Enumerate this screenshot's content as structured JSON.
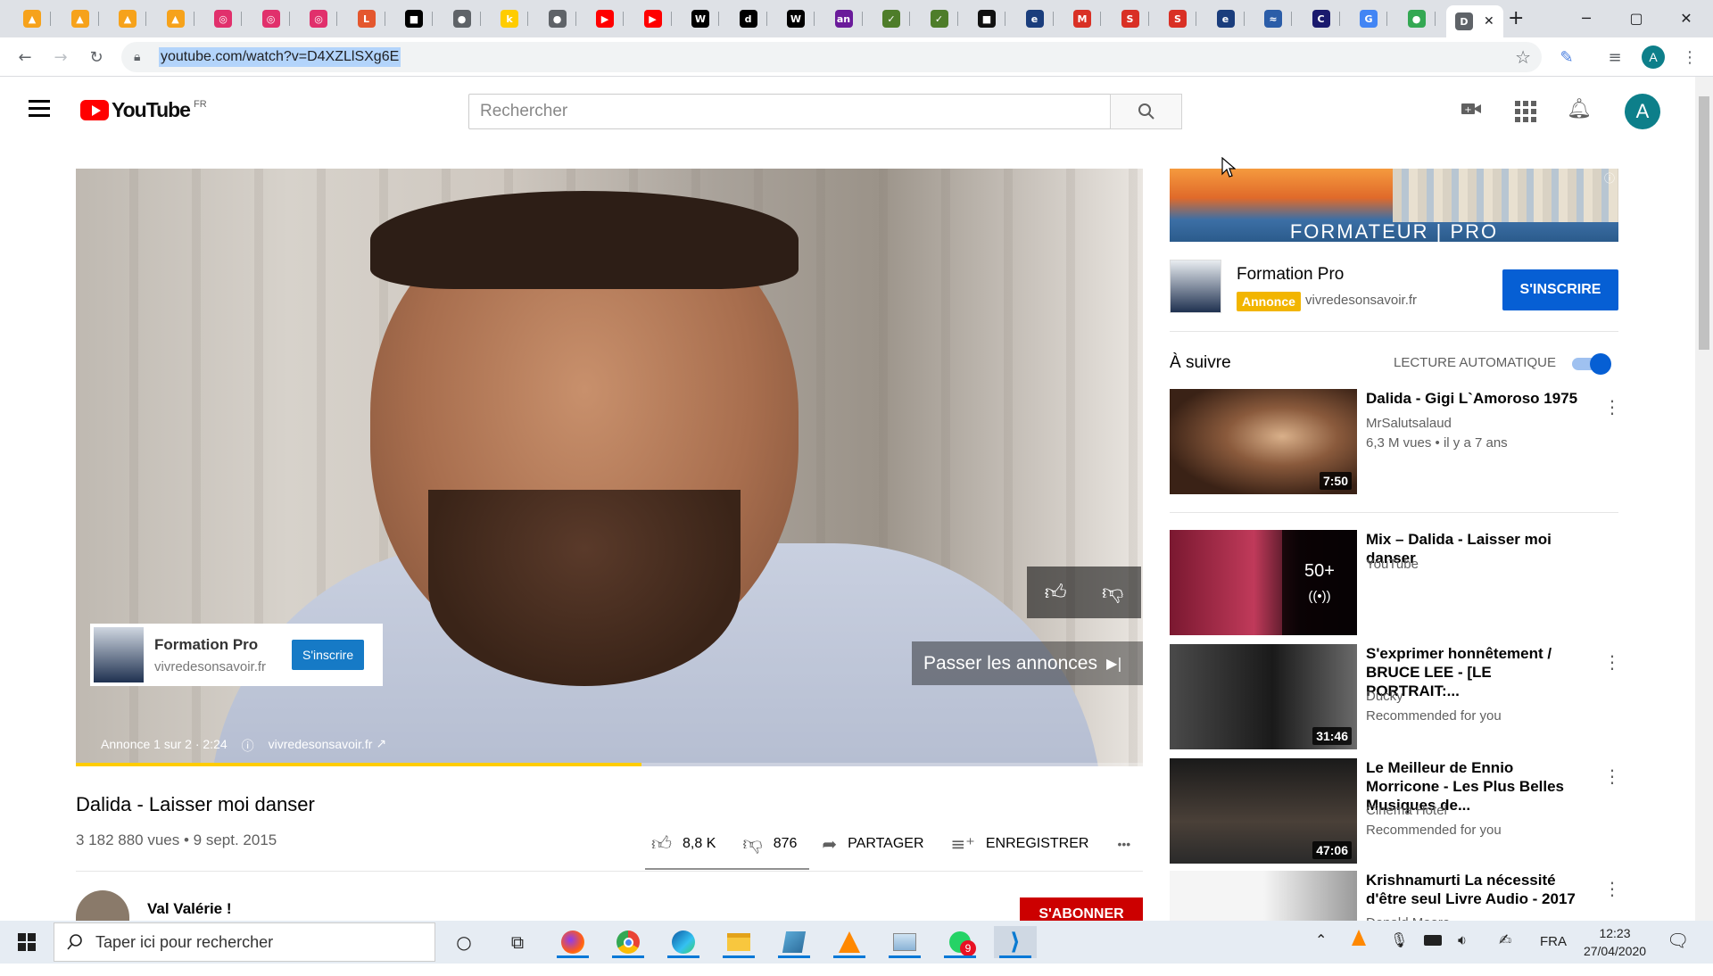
{
  "browser": {
    "tabs": [
      {
        "icon": "pma-icon",
        "glyph": "▲",
        "color": "#f6a21b"
      },
      {
        "icon": "pma-icon",
        "glyph": "▲",
        "color": "#f6a21b"
      },
      {
        "icon": "pma-icon",
        "glyph": "▲",
        "color": "#f6a21b"
      },
      {
        "icon": "pma-icon",
        "glyph": "▲",
        "color": "#f6a21b"
      },
      {
        "icon": "instagram-icon",
        "glyph": "◎",
        "color": "#e1306c"
      },
      {
        "icon": "instagram-icon",
        "glyph": "◎",
        "color": "#e1306c"
      },
      {
        "icon": "instagram-icon",
        "glyph": "◎",
        "color": "#e1306c"
      },
      {
        "icon": "l-icon",
        "glyph": "L",
        "color": "#e4572e"
      },
      {
        "icon": "square-icon",
        "glyph": "■",
        "color": "#000000"
      },
      {
        "icon": "globe-icon",
        "glyph": "●",
        "color": "#5f6368"
      },
      {
        "icon": "k-icon",
        "glyph": "k",
        "color": "#ffcc00"
      },
      {
        "icon": "globe-icon",
        "glyph": "●",
        "color": "#5f6368"
      },
      {
        "icon": "youtube-icon",
        "glyph": "▶",
        "color": "#ff0000"
      },
      {
        "icon": "youtube-icon",
        "glyph": "▶",
        "color": "#ff0000"
      },
      {
        "icon": "wikipedia-icon",
        "glyph": "W",
        "color": "#000000"
      },
      {
        "icon": "d-icon",
        "glyph": "d",
        "color": "#000000"
      },
      {
        "icon": "wikipedia-icon",
        "glyph": "W",
        "color": "#000000"
      },
      {
        "icon": "an-icon",
        "glyph": "an",
        "color": "#6a1b9a"
      },
      {
        "icon": "bird-icon",
        "glyph": "✓",
        "color": "#4e7d2a"
      },
      {
        "icon": "bird-icon",
        "glyph": "✓",
        "color": "#4e7d2a"
      },
      {
        "icon": "square-icon",
        "glyph": "■",
        "color": "#111111"
      },
      {
        "icon": "e-icon",
        "glyph": "e",
        "color": "#1a3d7c"
      },
      {
        "icon": "gmail-icon",
        "glyph": "M",
        "color": "#d93025"
      },
      {
        "icon": "sw-icon",
        "glyph": "S",
        "color": "#d93025"
      },
      {
        "icon": "sw-icon",
        "glyph": "S",
        "color": "#d93025"
      },
      {
        "icon": "e-icon",
        "glyph": "e",
        "color": "#1a3d7c"
      },
      {
        "icon": "ship-icon",
        "glyph": "≈",
        "color": "#2b5da8"
      },
      {
        "icon": "cpf-icon",
        "glyph": "C",
        "color": "#1a1a6e"
      },
      {
        "icon": "google-icon",
        "glyph": "G",
        "color": "#4285f4"
      },
      {
        "icon": "green-icon",
        "glyph": "●",
        "color": "#34a853"
      },
      {
        "icon": "d-icon",
        "glyph": "D",
        "color": "#5f6368"
      }
    ],
    "active_tab_close": "✕",
    "new_tab": "+",
    "url": "youtube.com/watch?v=D4XZLlSXg6E"
  },
  "youtube": {
    "logo_text": "YouTube",
    "region": "FR",
    "search_placeholder": "Rechercher",
    "avatar_letter": "A"
  },
  "player": {
    "like_dislike": [
      "thumb-up",
      "thumb-down"
    ],
    "ad_card": {
      "title": "Formation Pro",
      "domain": "vivredesonsavoir.fr",
      "button": "S'inscrire"
    },
    "skip_label": "Passer les annonces",
    "ad_info": "Annonce 1 sur 2 · 2:24",
    "ad_link": "vivredesonsavoir.fr",
    "progress_fraction": 0.53
  },
  "video": {
    "title": "Dalida - Laisser moi danser",
    "views_date": "3 182 880 vues • 9 sept. 2015",
    "likes": "8,8 K",
    "dislikes": "876",
    "share": "PARTAGER",
    "save": "ENREGISTRER",
    "more": "•••",
    "channel": "Val Valérie !",
    "subscribe": "S'ABONNER"
  },
  "sidebar_ad": {
    "banner_text": "FORMATEUR | PRO",
    "title": "Formation Pro",
    "badge": "Annonce",
    "domain": "vivredesonsavoir.fr",
    "button": "S'INSCRIRE"
  },
  "up_next": {
    "label": "À suivre",
    "autoplay": "LECTURE AUTOMATIQUE",
    "autoplay_on": true,
    "items": [
      {
        "title": "Dalida - Gigi L`Amoroso 1975",
        "channel": "MrSalutsalaud",
        "meta": "6,3 M vues • il y a 7 ans",
        "duration": "7:50",
        "thumb": "#7a4a30"
      },
      {
        "title": "Mix – Dalida - Laisser moi danser",
        "channel": "YouTube",
        "meta": "",
        "duration": "",
        "count": "50+",
        "live": "((•))",
        "thumb": "#5a1020"
      },
      {
        "title": "S'exprimer honnêtement / BRUCE LEE - [LE PORTRAIT:...",
        "channel": "Ducky",
        "meta": "Recommended for you",
        "duration": "31:46",
        "thumb": "#303030"
      },
      {
        "title": "Le Meilleur de Ennio Morricone - Les Plus Belles Musiques de...",
        "channel": "Cinema Hotel",
        "meta": "Recommended for you",
        "duration": "47:06",
        "thumb": "#2a2a2a"
      },
      {
        "title": "Krishnamurti La nécessité d'être seul Livre Audio - 2017",
        "channel": "Donald Moore",
        "meta": "",
        "duration": "",
        "thumb": "#e8e8e8"
      }
    ]
  },
  "taskbar": {
    "search_placeholder": "Taper ici pour rechercher",
    "language": "FRA",
    "time": "12:23",
    "date": "27/04/2020",
    "whatsapp_badge": "9"
  }
}
